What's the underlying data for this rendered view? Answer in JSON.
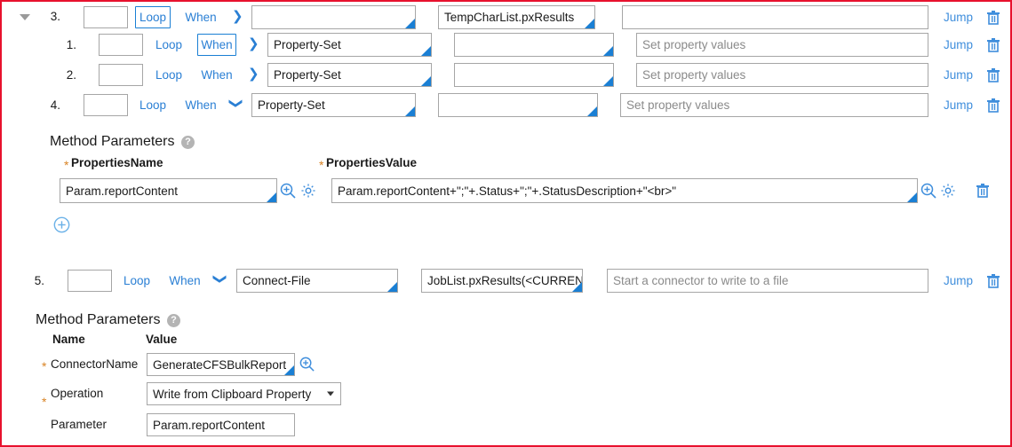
{
  "steps": [
    {
      "index": "3.",
      "expanded": true,
      "loop_label": "Loop",
      "when_label": "When",
      "selected_toggle": "loop",
      "chevron": "right",
      "method": "",
      "step_page": "TempCharList.pxResults",
      "description": "",
      "description_placeholder": "",
      "jump_label": "Jump"
    },
    {
      "index": "1.",
      "expanded": false,
      "loop_label": "Loop",
      "when_label": "When",
      "selected_toggle": "when",
      "chevron": "right",
      "method": "Property-Set",
      "step_page": "",
      "description": "",
      "description_placeholder": "Set property values",
      "jump_label": "Jump"
    },
    {
      "index": "2.",
      "expanded": false,
      "loop_label": "Loop",
      "when_label": "When",
      "selected_toggle": "none",
      "chevron": "right",
      "method": "Property-Set",
      "step_page": "",
      "description": "",
      "description_placeholder": "Set property values",
      "jump_label": "Jump"
    },
    {
      "index": "4.",
      "expanded": true,
      "loop_label": "Loop",
      "when_label": "When",
      "selected_toggle": "none",
      "chevron": "down",
      "method": "Property-Set",
      "step_page": "",
      "description": "",
      "description_placeholder": "Set property values",
      "jump_label": "Jump"
    }
  ],
  "method_params_1": {
    "title": "Method Parameters",
    "help": "?",
    "col_name_label": "PropertiesName",
    "col_value_label": "PropertiesValue",
    "required_marker": "*",
    "properties_name_value": "Param.reportContent",
    "properties_value_value": "Param.reportContent+\";\"+.Status+\";\"+.StatusDescription+\"<br>\"",
    "icons": {
      "expand": "magnifier-plus-icon",
      "settings": "gear-icon",
      "delete": "trash-icon",
      "add": "plus-circle-icon"
    }
  },
  "step5": {
    "index": "5.",
    "loop_label": "Loop",
    "when_label": "When",
    "selected_toggle": "none",
    "chevron": "down",
    "method": "Connect-File",
    "step_page": "JobList.pxResults(<CURRENT",
    "description": "",
    "description_placeholder": "Start a connector to write to a file",
    "jump_label": "Jump"
  },
  "method_params_2": {
    "title": "Method Parameters",
    "help": "?",
    "col_name_label": "Name",
    "col_value_label": "Value",
    "required_marker": "*",
    "rows": [
      {
        "name": "ConnectorName",
        "required": true,
        "value": "GenerateCFSBulkReport",
        "control": "lookup"
      },
      {
        "name": "Operation",
        "required": true,
        "value": "Write from Clipboard Property",
        "control": "select"
      },
      {
        "name": "Parameter",
        "required": false,
        "value": "Param.reportContent",
        "control": "text"
      }
    ]
  },
  "colors": {
    "accent_blue": "#1a7fd4",
    "link_blue": "#3f8edc",
    "border_gray": "#a6a6a6",
    "placeholder_gray": "#8a8a8a",
    "required_orange": "#d98324",
    "frame_red": "#e8112d"
  }
}
